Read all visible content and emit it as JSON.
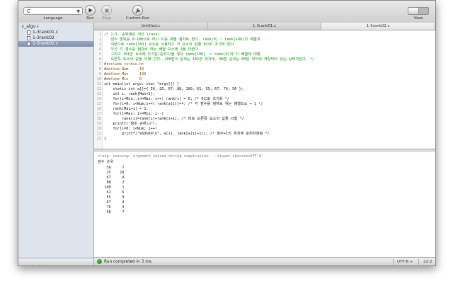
{
  "toolbar": {
    "language_value": "C",
    "language_label": "Language",
    "run_label": "Run",
    "stop_label": "Stop",
    "custom_run_label": "Custom Run",
    "view_label": "View"
  },
  "tabs": [
    {
      "label": "Untitled.c"
    },
    {
      "label": "1-3rank01.c"
    },
    {
      "label": "1-3rank02.c"
    }
  ],
  "sidebar": {
    "group": "c_algo",
    "files": [
      {
        "name": "1-3rank01.c"
      },
      {
        "name": "1-3rank02"
      },
      {
        "name": "1-3rank02.c"
      }
    ]
  },
  "editor": {
    "lines": [
      {
        "n": "1",
        "text": "/* 1-3. 순위매김 개선 (rank)",
        "cls": "cm"
      },
      {
        "n": "2",
        "text": "   점수 범위를 0~100으로 하고 이를 배열 첨자로 한다. rank[0] ~ rank[100]의 배열과",
        "cls": "cm"
      },
      {
        "n": "3",
        "text": "   여분으로 rank[101] 요소를 사용하고 각 요소의 값을 0으로 초기화 한다.",
        "cls": "cm"
      },
      {
        "n": "4",
        "text": "   우선 각 점수를 첨자로 하는 배열 요소에 1을 더한다.",
        "cls": "cm"
      },
      {
        "n": "5",
        "text": "   그리고 101번 요소에 초기값(순위1)을 넣고 rank[100] -> rank[0]의 각 배열에 대해",
        "cls": "cm"
      },
      {
        "n": "6",
        "text": "   오른쪽 요소의 값을 더해 간다. 100점의 순위는 101번 위치에, 88점 순위는 89번 위치에 저장되어 있는 상태가된다. */",
        "cls": "cm"
      },
      {
        "n": "7",
        "text": "#include <stdio.h>",
        "cls": "pp"
      },
      {
        "n": "8",
        "text": "#define Num     10",
        "cls": "pp"
      },
      {
        "n": "9",
        "text": "#define Max     100",
        "cls": "pp"
      },
      {
        "n": "10",
        "text": "#define Min     0",
        "cls": "pp"
      },
      {
        "n": "11",
        "text": "int main(int argc, char *argv[]) {",
        "cls": "tx"
      },
      {
        "n": "12",
        "text": "    static int a[]={ 56, 25, 67, 88, 100, 61, 55, 67, 76, 56 };",
        "cls": "tx"
      },
      {
        "n": "13",
        "text": "    int i, rank[Max+2];",
        "cls": "tx"
      },
      {
        "n": "14",
        "text": "    for(i=Min; i<=Max; i++) rank[i] = 0; /* 0으로 초기화 */",
        "cls": "tx"
      },
      {
        "n": "15",
        "text": "    for(i=0; i<Num;i++) rank[a[i]]++; /* 각 점수를 첨자로 하는 배열요소 + 1 */",
        "cls": "tx"
      },
      {
        "n": "16",
        "text": "    rank[Max+1] = 1;",
        "cls": "tx"
      },
      {
        "n": "17",
        "text": "    for(i=Max; i>=Min; i--)",
        "cls": "tx"
      },
      {
        "n": "18",
        "text": "        rank[i]=rank[i]+rank[i+1]; /* 바로 오른쪽 요소의 값을 더함 */",
        "cls": "tx"
      },
      {
        "n": "19",
        "text": "    printf(\"점수 순위\\n\");",
        "cls": "tx"
      },
      {
        "n": "20",
        "text": "    for(i=0; i<Num; i++)",
        "cls": "tx"
      },
      {
        "n": "21",
        "text": "        printf(\"%6d%6d\\n\", a[i], rank[a[i]+1]); /* 점수+1의 위치에 순위저장됨 */",
        "cls": "tx"
      },
      {
        "n": "22",
        "text": "}",
        "cls": "tx"
      }
    ]
  },
  "console": {
    "warning": "clang: warning: argument unused during compilation: '-finput-charset=UTF-8'",
    "header": "점수 순위",
    "rows": [
      "    56     7",
      "    25    10",
      "    67     4",
      "    88     2",
      "   100     1",
      "    61     6",
      "    55     9",
      "    67     4",
      "    76     3",
      "    56     7"
    ]
  },
  "status": {
    "text": "Run completed in 3 ms",
    "encoding": "UTF-8 ÷",
    "position": "22:2"
  },
  "colors": {
    "comment": "#148a14",
    "keyword": "#9b2393",
    "string": "#c41a16",
    "selection": "#7c8fae",
    "success": "#2aa52a"
  }
}
